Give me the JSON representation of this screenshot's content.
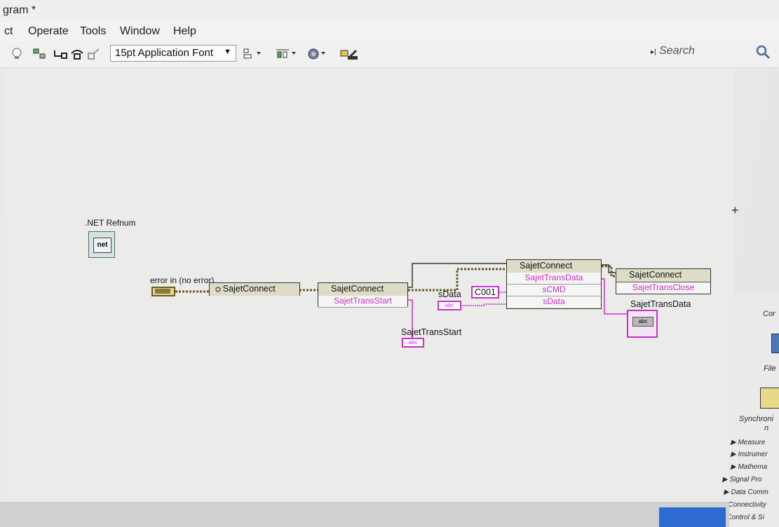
{
  "window": {
    "title": "gram *"
  },
  "menu": {
    "items": [
      "ct",
      "Operate",
      "Tools",
      "Window",
      "Help"
    ]
  },
  "toolbar": {
    "font": "15pt Application Font",
    "search_placeholder": "Search"
  },
  "diagram": {
    "refnum_label": ".NET Refnum",
    "error_in_label": "error in (no error)",
    "node1_title": "SajetConnect",
    "node2_title": "SajetConnect",
    "node2_prop": "SajetTransStart",
    "node3_title": "SajetConnect",
    "node3_props": [
      "SajetTransData",
      "sCMD",
      "sData"
    ],
    "node4_title": "SajetConnect",
    "node4_prop": "SajetTransClose",
    "sdata_label": "sData",
    "const_c001": "C001",
    "trans_start_indicator": "SajetTransStart",
    "trans_data_indicator": "SajetTransData",
    "abc_glyph": "abc",
    "net_glyph": "net"
  },
  "palette": {
    "labels": [
      "Cor",
      "File",
      "Synchroni",
      "n"
    ],
    "items": [
      "Measure",
      "Instrumer",
      "Mathema",
      "Signal Pro",
      "Data Comm",
      "Connectivity",
      "Control & Si"
    ]
  },
  "colors": {
    "wire_string": "#c832c8",
    "wire_error": "#6b5a1f",
    "wire_refnum": "#2e7d5e"
  }
}
